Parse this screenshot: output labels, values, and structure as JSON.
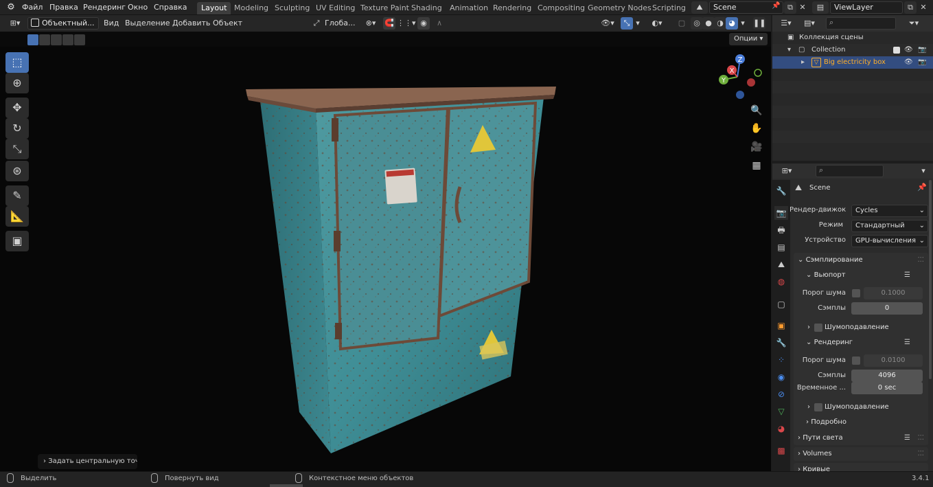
{
  "topbar": {
    "menus": [
      "Файл",
      "Правка",
      "Рендеринг",
      "Окно",
      "Справка"
    ],
    "workspaces": [
      "Layout",
      "Modeling",
      "Sculpting",
      "UV Editing",
      "Texture Paint",
      "Shading",
      "Animation",
      "Rendering",
      "Compositing",
      "Geometry Nodes",
      "Scripting"
    ],
    "active_workspace": "Layout",
    "scene": "Scene",
    "view_layer": "ViewLayer"
  },
  "viewport_header": {
    "mode": "Объектный...",
    "menus": [
      "Вид",
      "Выделение",
      "Добавить",
      "Объект"
    ],
    "orientation": "Глоба...",
    "options": "Опции"
  },
  "toolbar": {
    "tools": [
      "select-box-icon",
      "cursor-icon",
      "move-icon",
      "rotate-icon",
      "scale-icon",
      "transform-icon",
      "annotate-icon",
      "measure-icon",
      "add-cube-icon"
    ]
  },
  "gizmo": {
    "x": "X",
    "y": "Y",
    "z": "Z"
  },
  "last_operator": "Задать центральную точк",
  "status_bar": {
    "select": "Выделить",
    "rotate": "Повернуть вид",
    "context": "Контекстное меню объектов",
    "version": "3.4.1"
  },
  "outliner": {
    "scene_collection": "Коллекция сцены",
    "collection": "Collection",
    "object": "Big electricity box"
  },
  "properties": {
    "title": "Scene",
    "render_engine_label": "Рендер-движок",
    "render_engine": "Cycles",
    "mode_label": "Режим",
    "mode": "Стандартный",
    "device_label": "Устройство",
    "device": "GPU-вычисления",
    "sampling": "Сэмплирование",
    "viewport": "Вьюпорт",
    "noise_threshold_label": "Порог шума",
    "viewport_noise_threshold": "0.1000",
    "samples_label": "Сэмплы",
    "viewport_samples": "0",
    "denoise_label": "Шумоподавление",
    "render": "Рендеринг",
    "render_noise_threshold": "0.0100",
    "render_samples": "4096",
    "time_limit_label": "Временное ...",
    "time_limit": "0 sec",
    "advanced": "Подробно",
    "light_paths": "Пути света",
    "volumes": "Volumes",
    "curves": "Кривые"
  },
  "colors": {
    "accent": "#4772b3",
    "selected_row": "#334d80",
    "object_label": "#ffaf29",
    "cabinet": "#3f8e96"
  }
}
